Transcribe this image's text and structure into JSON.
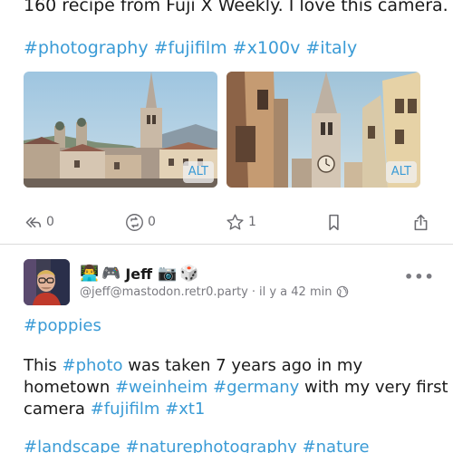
{
  "post1": {
    "text_tail": "160 recipe from Fuji X Weekly. I love this camera.",
    "hashtags": [
      "#photography",
      "#fujifilm",
      "#x100v",
      "#italy"
    ],
    "media": [
      {
        "alt_label": "ALT"
      },
      {
        "alt_label": "ALT"
      }
    ],
    "actions": {
      "reply_count": "0",
      "boost_count": "0",
      "favorite_count": "1"
    }
  },
  "post2": {
    "emojis_before": [
      "👨‍💻",
      "🎮"
    ],
    "display_name": "Jeff",
    "emojis_after": [
      "📷",
      "🎲"
    ],
    "handle": "@jeff@mastodon.retr0.party",
    "separator": "·",
    "time": "il y a 42 min",
    "hashtag_line": "#poppies",
    "body_line1": {
      "before": "This ",
      "tag1": "#photo",
      "after": " was taken 7 years ago in my"
    },
    "body_line2": {
      "before": "hometown ",
      "tag1": "#weinheim",
      "space": " ",
      "tag2": "#germany",
      "after": " with my very first"
    },
    "body_line3": {
      "before": "camera ",
      "tag1": "#fujifilm",
      "space": " ",
      "tag2": "#xt1"
    },
    "hashtags_bottom": [
      "#landscape",
      "#naturephotography",
      "#nature"
    ]
  },
  "colors": {
    "accent": "#3a9bd6",
    "muted": "#6b6b70",
    "divider": "#dcdcdc"
  }
}
